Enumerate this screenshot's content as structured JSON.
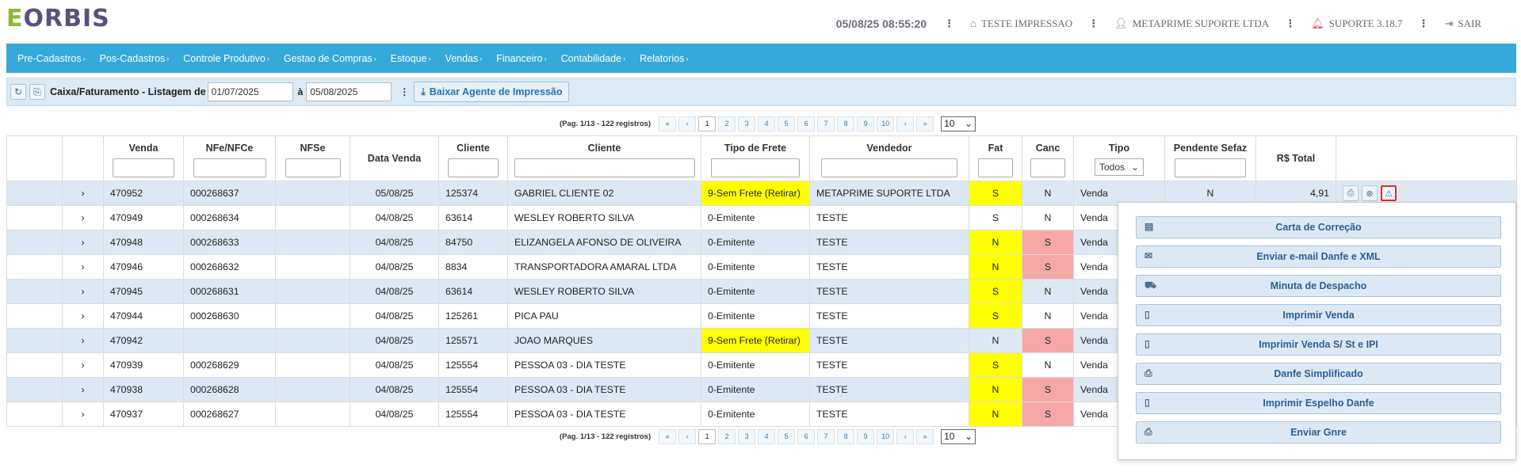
{
  "header": {
    "logo_e": "E",
    "logo_rest": "ORBIS",
    "datetime": "05/08/25 08:55:20",
    "company": "TESTE IMPRESSAO",
    "user": "METAPRIME SUPORTE LTDA",
    "support": "SUPORTE 3.18.7",
    "logout": "SAIR",
    "dots": "⋮"
  },
  "menu": [
    "Pre-Cadastros",
    "Pos-Cadastros",
    "Controle Produtivo",
    "Gestao de Compras",
    "Estoque",
    "Vendas",
    "Financeiro",
    "Contabilidade",
    "Relatorios"
  ],
  "toolbar": {
    "title": "Caixa/Faturamento - Listagem de",
    "date_from": "01/07/2025",
    "between": "à",
    "date_to": "05/08/2025",
    "agent_button": "Baixar Agente de Impressão"
  },
  "pager": {
    "info": "(Pag. 1/13 - 122 registros)",
    "first": "«",
    "prev": "‹",
    "pages": [
      "1",
      "2",
      "3",
      "4",
      "5",
      "6",
      "7",
      "8",
      "9",
      "10"
    ],
    "next": "›",
    "last": "»",
    "page_size": "10"
  },
  "table": {
    "columns": [
      "",
      "",
      "Venda",
      "NFe/NFCe",
      "NFSe",
      "Data Venda",
      "Cliente",
      "Cliente",
      "Tipo de Frete",
      "Vendedor",
      "Fat",
      "Canc",
      "Tipo",
      "Pendente Sefaz",
      "R$ Total",
      ""
    ],
    "tipo_filter": "Todos",
    "rows": [
      {
        "venda": "470952",
        "nfe": "000268637",
        "nfse": "",
        "data": "05/08/25",
        "cod": "125374",
        "cliente": "GABRIEL CLIENTE 02",
        "frete": "9-Sem Frete (Retirar)",
        "vendedor": "METAPRIME SUPORTE LTDA",
        "fat": "S",
        "canc": "N",
        "tipo": "Venda",
        "pendente": "N",
        "total": "4,91"
      },
      {
        "venda": "470949",
        "nfe": "000268634",
        "nfse": "",
        "data": "04/08/25",
        "cod": "63614",
        "cliente": "WESLEY ROBERTO SILVA",
        "frete": "0-Emitente",
        "vendedor": "TESTE",
        "fat": "S",
        "canc": "N",
        "tipo": "Venda",
        "pendente": "",
        "total": ""
      },
      {
        "venda": "470948",
        "nfe": "000268633",
        "nfse": "",
        "data": "04/08/25",
        "cod": "84750",
        "cliente": "ELIZANGELA AFONSO DE OLIVEIRA",
        "frete": "0-Emitente",
        "vendedor": "TESTE",
        "fat": "N",
        "canc": "S",
        "tipo": "Venda",
        "pendente": "",
        "total": ""
      },
      {
        "venda": "470946",
        "nfe": "000268632",
        "nfse": "",
        "data": "04/08/25",
        "cod": "8834",
        "cliente": "TRANSPORTADORA AMARAL LTDA",
        "frete": "0-Emitente",
        "vendedor": "TESTE",
        "fat": "N",
        "canc": "S",
        "tipo": "Venda",
        "pendente": "",
        "total": ""
      },
      {
        "venda": "470945",
        "nfe": "000268631",
        "nfse": "",
        "data": "04/08/25",
        "cod": "63614",
        "cliente": "WESLEY ROBERTO SILVA",
        "frete": "0-Emitente",
        "vendedor": "TESTE",
        "fat": "S",
        "canc": "N",
        "tipo": "Venda",
        "pendente": "",
        "total": ""
      },
      {
        "venda": "470944",
        "nfe": "000268630",
        "nfse": "",
        "data": "04/08/25",
        "cod": "125261",
        "cliente": "PICA PAU",
        "frete": "0-Emitente",
        "vendedor": "TESTE",
        "fat": "S",
        "canc": "N",
        "tipo": "Venda",
        "pendente": "",
        "total": ""
      },
      {
        "venda": "470942",
        "nfe": "",
        "nfse": "",
        "data": "04/08/25",
        "cod": "125571",
        "cliente": "JOAO MARQUES",
        "frete": "9-Sem Frete (Retirar)",
        "vendedor": "TESTE",
        "fat": "N",
        "canc": "S",
        "tipo": "Venda",
        "pendente": "",
        "total": ""
      },
      {
        "venda": "470939",
        "nfe": "000268629",
        "nfse": "",
        "data": "04/08/25",
        "cod": "125554",
        "cliente": "PESSOA 03 - DIA TESTE",
        "frete": "0-Emitente",
        "vendedor": "TESTE",
        "fat": "S",
        "canc": "N",
        "tipo": "Venda",
        "pendente": "",
        "total": ""
      },
      {
        "venda": "470938",
        "nfe": "000268628",
        "nfse": "",
        "data": "04/08/25",
        "cod": "125554",
        "cliente": "PESSOA 03 - DIA TESTE",
        "frete": "0-Emitente",
        "vendedor": "TESTE",
        "fat": "N",
        "canc": "S",
        "tipo": "Venda",
        "pendente": "",
        "total": ""
      },
      {
        "venda": "470937",
        "nfe": "000268627",
        "nfse": "",
        "data": "04/08/25",
        "cod": "125554",
        "cliente": "PESSOA 03 - DIA TESTE",
        "frete": "0-Emitente",
        "vendedor": "TESTE",
        "fat": "N",
        "canc": "S",
        "tipo": "Venda",
        "pendente": "",
        "total": ""
      }
    ]
  },
  "popup": [
    {
      "label": "Carta de Correção",
      "icon": "document-icon"
    },
    {
      "label": "Enviar e-mail Danfe e XML",
      "icon": "envelope-icon"
    },
    {
      "label": "Minuta de Despacho",
      "icon": "truck-icon"
    },
    {
      "label": "Imprimir Venda",
      "icon": "file-icon"
    },
    {
      "label": "Imprimir Venda S/ St e IPI",
      "icon": "file-icon"
    },
    {
      "label": "Danfe Simplificado",
      "icon": "printer-icon"
    },
    {
      "label": "Imprimir Espelho Danfe",
      "icon": "file-icon"
    },
    {
      "label": "Enviar Gnre",
      "icon": "printer-icon"
    }
  ],
  "colors": {
    "menu_bg": "#35a9da",
    "yellow": "#ffff00",
    "pink": "#f6a7a7",
    "row_alt": "#dce9f5",
    "alert": "#e0262c"
  }
}
